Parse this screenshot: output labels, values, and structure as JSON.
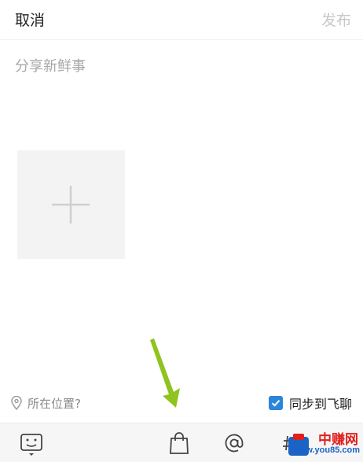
{
  "header": {
    "cancel_label": "取消",
    "publish_label": "发布"
  },
  "compose": {
    "placeholder": "分享新鲜事"
  },
  "media": {
    "add_icon": "plus-icon"
  },
  "footer": {
    "location_label": "所在位置?",
    "sync_label": "同步到飞聊",
    "sync_checked": true
  },
  "toolbar": {
    "items": [
      "keyboard-emoji-icon",
      "shopping-bag-icon",
      "at-icon",
      "hashtag-icon"
    ]
  },
  "watermark": {
    "brand": "中赚网",
    "url": "www.you85.com"
  },
  "colors": {
    "accent": "#2b86d9",
    "disabled_text": "#c8c8c8",
    "placeholder_text": "#a8a8a8",
    "arrow": "#8fc31f",
    "watermark_red": "#e0201c",
    "watermark_blue": "#1b63c4"
  }
}
